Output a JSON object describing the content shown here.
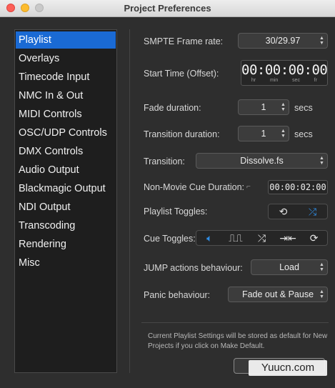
{
  "window": {
    "title": "Project Preferences"
  },
  "sidebar": {
    "items": [
      {
        "label": "Playlist",
        "active": true
      },
      {
        "label": "Overlays"
      },
      {
        "label": "Timecode Input"
      },
      {
        "label": "NMC In & Out"
      },
      {
        "label": "MIDI Controls"
      },
      {
        "label": "OSC/UDP Controls"
      },
      {
        "label": "DMX Controls"
      },
      {
        "label": "Audio Output"
      },
      {
        "label": "Blackmagic Output"
      },
      {
        "label": "NDI Output"
      },
      {
        "label": "Transcoding"
      },
      {
        "label": "Rendering"
      },
      {
        "label": "Misc"
      }
    ]
  },
  "settings": {
    "smpte_label": "SMPTE Frame rate:",
    "smpte_value": "30/29.97",
    "start_label": "Start Time (Offset):",
    "start_value": "00:00:00:00",
    "start_units": [
      "hr",
      "min",
      "sec",
      "fr"
    ],
    "fade_label": "Fade duration:",
    "fade_value": "1",
    "fade_unit": "secs",
    "transition_duration_label": "Transition duration:",
    "transition_duration_value": "1",
    "transition_duration_unit": "secs",
    "transition_label": "Transition:",
    "transition_value": "Dissolve.fs",
    "nonmovie_label": "Non-Movie Cue Duration:",
    "nonmovie_value": "00:00:02:00",
    "playlist_toggles_label": "Playlist Toggles:",
    "cue_toggles_label": "Cue Toggles:",
    "jump_label": "JUMP actions behaviour:",
    "jump_value": "Load",
    "panic_label": "Panic behaviour:",
    "panic_value": "Fade out & Pause"
  },
  "footer": {
    "note": "Current Playlist Settings will be stored as default for New Projects if you click on Make Default.",
    "watermark": "Yuucn.com"
  },
  "icons": {
    "playlist_toggles": [
      "loop-icon",
      "shuffle-icon"
    ],
    "cue_toggles": [
      "audio-icon",
      "fade-in-out-icon",
      "shuffle-icon",
      "skip-icon",
      "repeat-icon"
    ]
  },
  "colors": {
    "accent": "#1a6ad4",
    "toggle_on": "#2f8fe8"
  }
}
